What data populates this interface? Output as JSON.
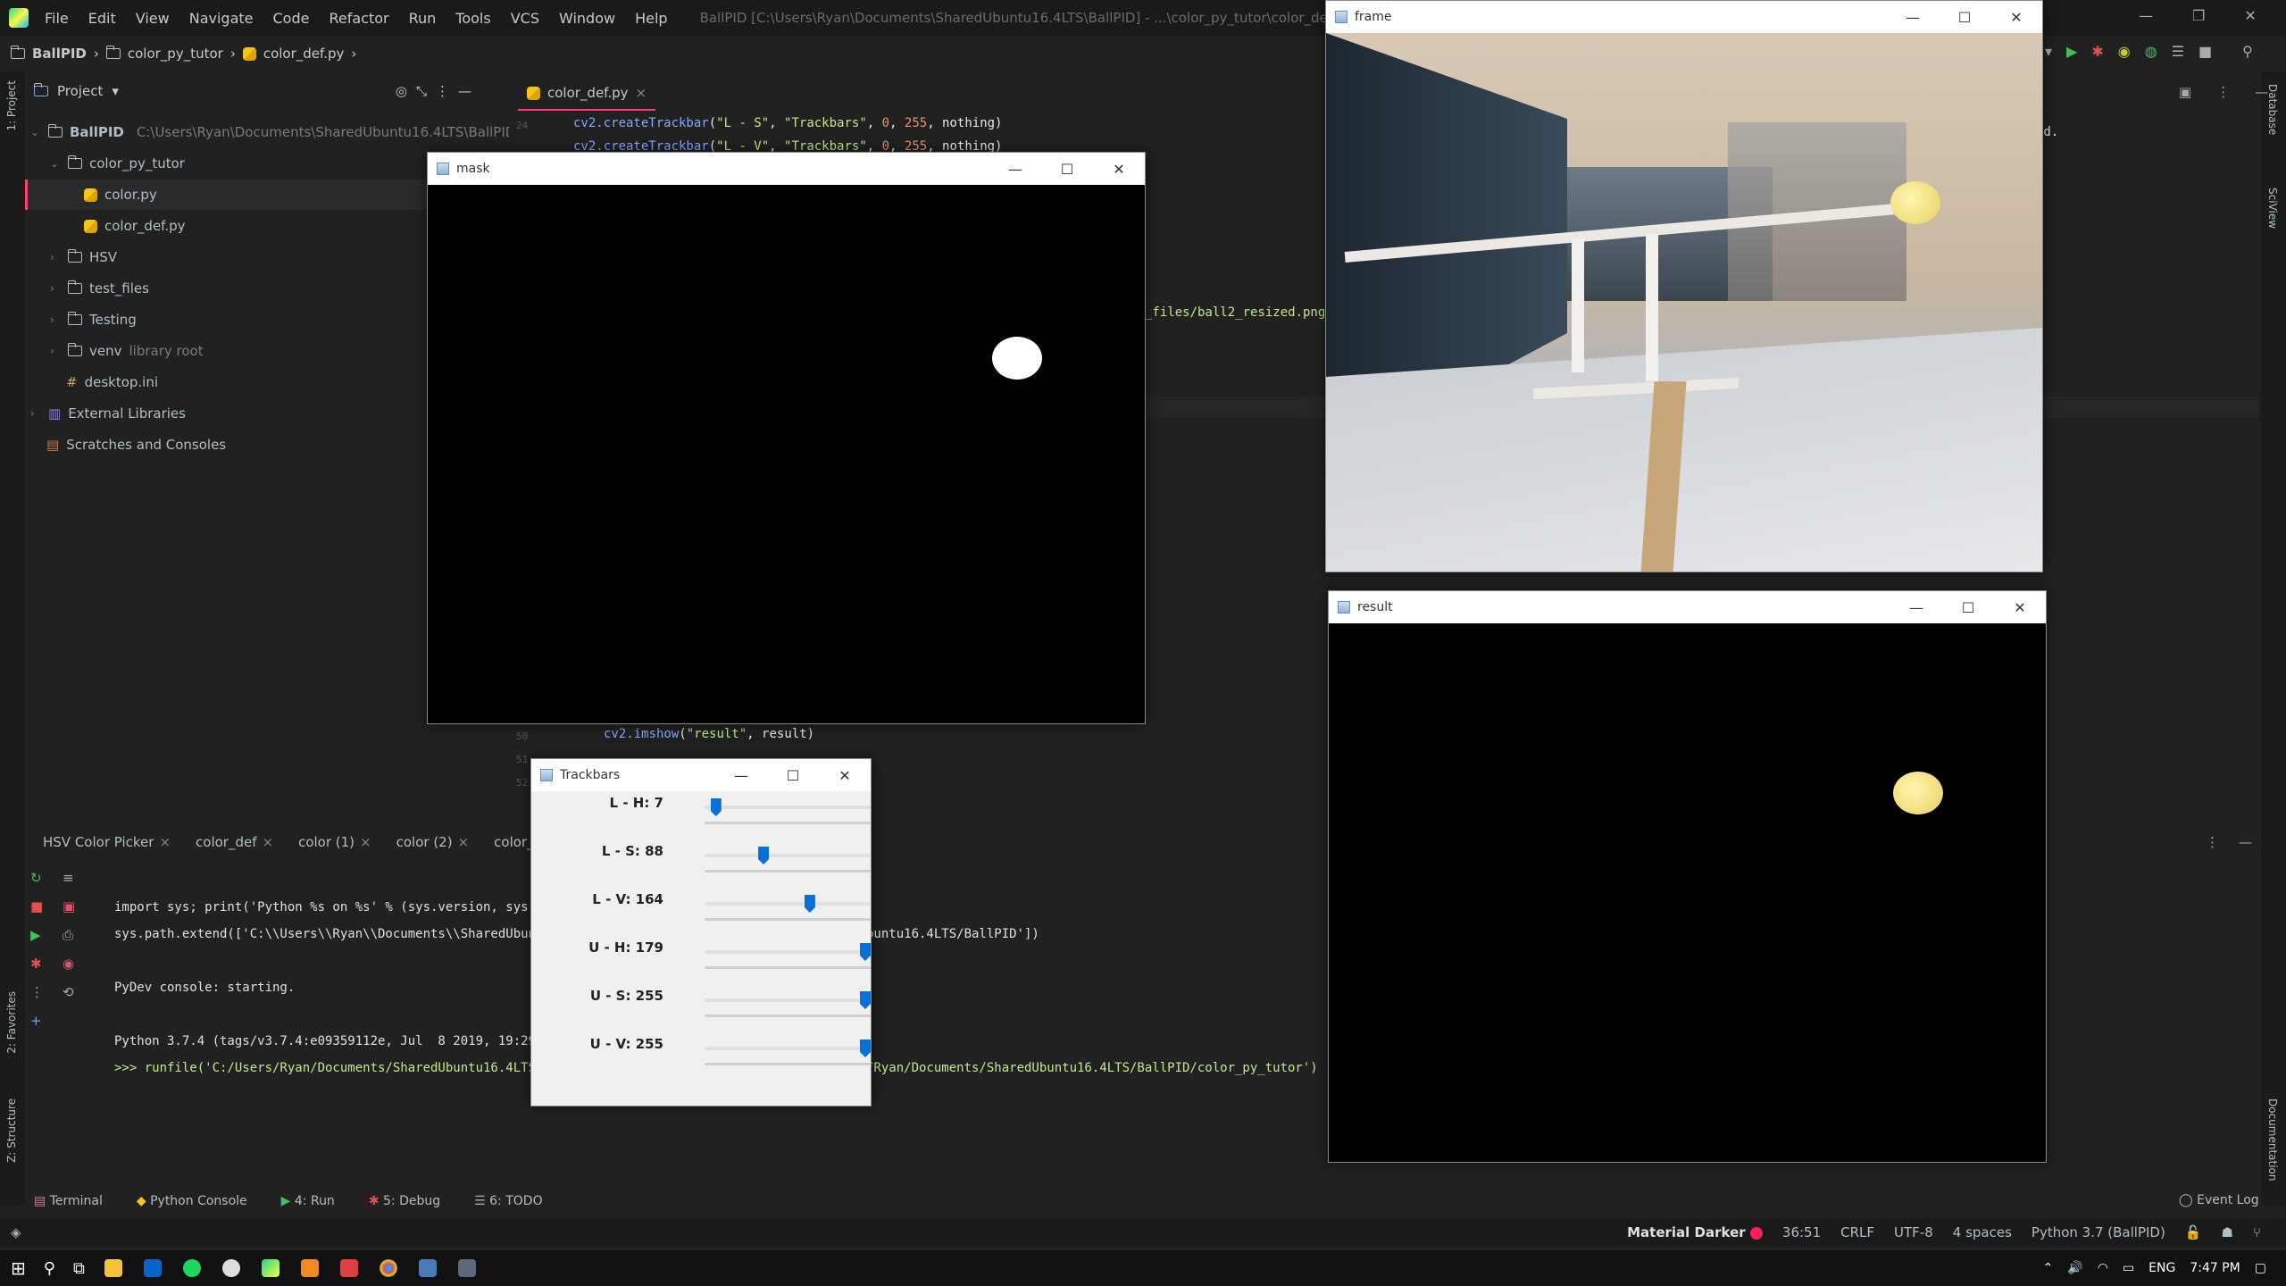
{
  "titlebar": {
    "menu": [
      "File",
      "Edit",
      "View",
      "Navigate",
      "Code",
      "Refactor",
      "Run",
      "Tools",
      "VCS",
      "Window",
      "Help"
    ],
    "window_title": "BallPID [C:\\Users\\Ryan\\Documents\\SharedUbuntu16.4LTS\\BallPID] - ...\\color_py_tutor\\color_def.py - PyCharm"
  },
  "breadcrumb": {
    "project": "BallPID",
    "folder": "color_py_tutor",
    "file": "color_def.py"
  },
  "side_strip": {
    "project": "1: Project",
    "favorites": "2: Favorites",
    "structure": "Z: Structure",
    "database": "Database",
    "sciview": "SciView",
    "documentation": "Documentation"
  },
  "project_panel": {
    "title": "Project",
    "root": {
      "name": "BallPID",
      "path": "C:\\Users\\Ryan\\Documents\\SharedUbuntu16.4LTS\\BallPID"
    },
    "items": [
      {
        "label": "color_py_tutor",
        "type": "folder"
      },
      {
        "label": "color.py",
        "type": "py"
      },
      {
        "label": "color_def.py",
        "type": "py"
      },
      {
        "label": "HSV",
        "type": "folder"
      },
      {
        "label": "test_files",
        "type": "folder"
      },
      {
        "label": "Testing",
        "type": "folder"
      },
      {
        "label": "venv",
        "type": "folder",
        "sub": "library root"
      },
      {
        "label": "desktop.ini",
        "type": "file"
      },
      {
        "label": "External Libraries",
        "type": "lib"
      },
      {
        "label": "Scratches and Consoles",
        "type": "scratch"
      }
    ]
  },
  "editor": {
    "tab": "color_def.py",
    "lines": {
      "l24_num": "24",
      "l24": "cv2.createTrackbar(\"L - S\", \"Trackbars\", 0, 255, nothing)",
      "l25": "cv2.createTrackbar(\"L - V\", \"Trackbars\", 0, 255, nothing)",
      "frag_resized": "_files/ball2_resized.png'",
      "frag_nd": "nd.",
      "l50_num": "50",
      "l50": "cv2.imshow(\"result\", result)",
      "l51_num": "51",
      "l52_num": "52"
    }
  },
  "bottom_tabs": [
    "HSV Color Picker",
    "color_def",
    "color (1)",
    "color (2)",
    "color_def"
  ],
  "console": {
    "lines": [
      "import sys; print('Python %s on %s' % (sys.version, sys.platfo",
      "sys.path.extend(['C:\\\\Users\\\\Ryan\\\\Documents\\\\SharedUbuntu16.4",
      "PyDev console: starting.",
      "Python 3.7.4 (tags/v3.7.4:e09359112e, Jul  8 2019, 19:29:22) [",
      ">>> runfile('C:/Users/Ryan/Documents/SharedUbuntu16.4LTS/BallP"
    ],
    "right_frag_1": "buntu16.4LTS/BallPID'])",
    "right_frag_2": "/Ryan/Documents/SharedUbuntu16.4LTS/BallPID/color_py_tutor')"
  },
  "tool_windows": [
    "Terminal",
    "Python Console",
    "4: Run",
    "5: Debug",
    "6: TODO"
  ],
  "event_log": "Event Log",
  "statusbar": {
    "theme": "Material Darker",
    "position": "36:51",
    "line_sep": "CRLF",
    "encoding": "UTF-8",
    "indent": "4 spaces",
    "interpreter": "Python 3.7 (BallPID)"
  },
  "taskbar": {
    "lang": "ENG",
    "time": "7:47 PM"
  },
  "mask_window": {
    "title": "mask"
  },
  "frame_window": {
    "title": "frame"
  },
  "result_window": {
    "title": "result"
  },
  "trackbars_window": {
    "title": "Trackbars",
    "sliders": [
      {
        "label": "L - H: 7",
        "value": 7,
        "max": 179
      },
      {
        "label": "L - S: 88",
        "value": 88,
        "max": 255
      },
      {
        "label": "L - V: 164",
        "value": 164,
        "max": 255
      },
      {
        "label": "U - H: 179",
        "value": 179,
        "max": 179
      },
      {
        "label": "U - S: 255",
        "value": 255,
        "max": 255
      },
      {
        "label": "U - V: 255",
        "value": 255,
        "max": 255
      }
    ]
  },
  "colors": {
    "accent": "#ff4070",
    "bg": "#212121",
    "slider_thumb": "#0a6fd6"
  }
}
